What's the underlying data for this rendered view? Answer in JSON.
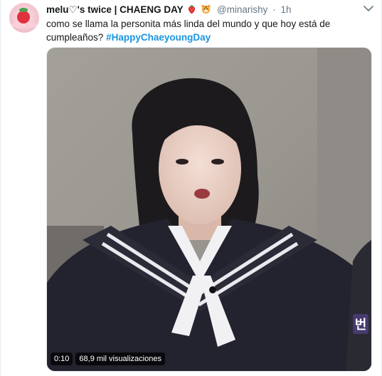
{
  "tweet": {
    "display_name": "melu♡'s twice | CHAENG DAY",
    "display_name_emojis": [
      "strawberry-emoji",
      "tiger-emoji"
    ],
    "handle": "@minarishy",
    "separator": "·",
    "timestamp": "1h",
    "text_part1": "como se llama la personita más linda del mundo y que hoy está de cumpleaños? ",
    "hashtag": "#HappyChaeyoungDay"
  },
  "video": {
    "duration": "0:10",
    "views": "68,9 mil visualizaciones",
    "subtitle_glyph": "번"
  },
  "colors": {
    "link": "#1b95e0",
    "secondary_text": "#657786"
  }
}
